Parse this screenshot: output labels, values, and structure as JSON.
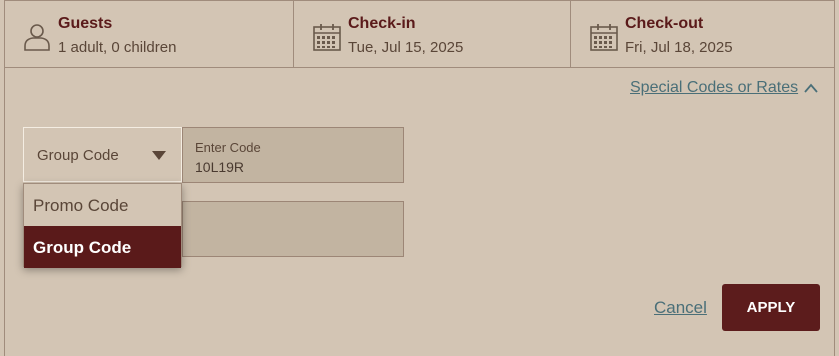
{
  "header": {
    "guests": {
      "title": "Guests",
      "value": "1 adult, 0 children",
      "icon": "person-icon"
    },
    "checkin": {
      "title": "Check-in",
      "value": "Tue, Jul 15, 2025",
      "icon": "calendar-icon"
    },
    "checkout": {
      "title": "Check-out",
      "value": "Fri, Jul 18, 2025",
      "icon": "calendar-icon"
    }
  },
  "special_codes": {
    "label": "Special Codes or Rates",
    "icon": "chevron-up-icon"
  },
  "code_type": {
    "selected": "Group Code",
    "options": [
      "Promo Code",
      "Group Code"
    ],
    "icon": "caret-down-icon"
  },
  "code_input": {
    "label": "Enter Code",
    "value": "10L19R"
  },
  "actions": {
    "cancel_label": "Cancel",
    "apply_label": "APPLY"
  },
  "colors": {
    "background": "#d3c5b4",
    "brand": "#5c1c1c",
    "link": "#4a6f78",
    "title": "#5a1a1a"
  }
}
